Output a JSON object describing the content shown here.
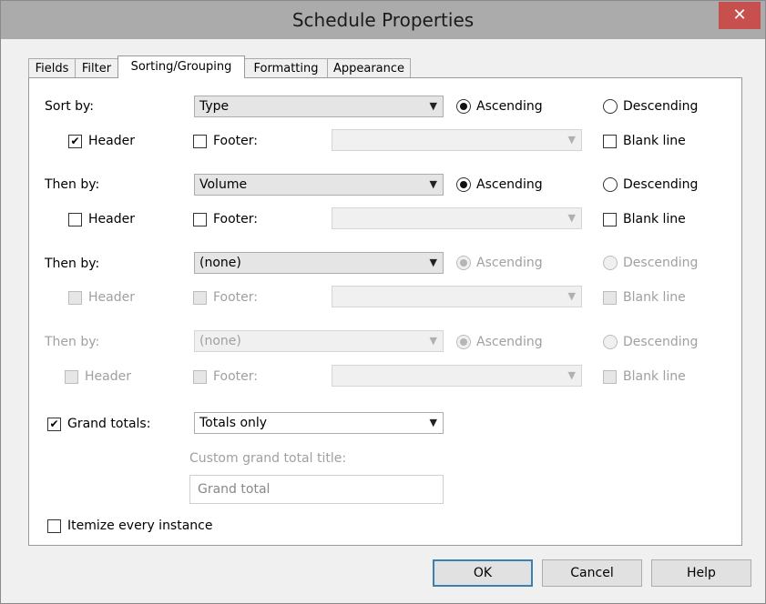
{
  "window": {
    "title": "Schedule Properties",
    "close_label": "✕"
  },
  "tabs": [
    {
      "label": "Fields"
    },
    {
      "label": "Filter"
    },
    {
      "label": "Sorting/Grouping"
    },
    {
      "label": "Formatting"
    },
    {
      "label": "Appearance"
    }
  ],
  "active_tab": "Sorting/Grouping",
  "sort_rows": [
    {
      "label": "Sort by:",
      "field": "Type",
      "ascending": "Ascending",
      "descending": "Descending",
      "order": "ascending",
      "header": "Header",
      "header_checked": true,
      "footer": "Footer:",
      "footer_checked": false,
      "footer_value": "",
      "blank_line": "Blank line",
      "blank_checked": false,
      "enabled": true
    },
    {
      "label": "Then by:",
      "field": "Volume",
      "ascending": "Ascending",
      "descending": "Descending",
      "order": "ascending",
      "header": "Header",
      "header_checked": false,
      "footer": "Footer:",
      "footer_checked": false,
      "footer_value": "",
      "blank_line": "Blank line",
      "blank_checked": false,
      "enabled": true
    },
    {
      "label": "Then by:",
      "field": "(none)",
      "ascending": "Ascending",
      "descending": "Descending",
      "order": "ascending",
      "header": "Header",
      "header_checked": false,
      "footer": "Footer:",
      "footer_checked": false,
      "footer_value": "",
      "blank_line": "Blank line",
      "blank_checked": false,
      "enabled": "field-only"
    },
    {
      "label": "Then by:",
      "field": "(none)",
      "ascending": "Ascending",
      "descending": "Descending",
      "order": "ascending",
      "header": "Header",
      "header_checked": false,
      "footer": "Footer:",
      "footer_checked": false,
      "footer_value": "",
      "blank_line": "Blank line",
      "blank_checked": false,
      "enabled": false
    }
  ],
  "grand_totals": {
    "label": "Grand totals:",
    "checked": true,
    "value": "Totals only",
    "custom_title_label": "Custom grand total title:",
    "custom_title_value": "Grand total"
  },
  "itemize": {
    "label": "Itemize every instance",
    "checked": false
  },
  "buttons": {
    "ok": "OK",
    "cancel": "Cancel",
    "help": "Help"
  },
  "icons": {
    "dropdown": "chevron-down-icon",
    "check": "checkmark-icon",
    "close": "close-icon"
  },
  "colors": {
    "titlebar": "#ababab",
    "close": "#c7504f",
    "panel": "#ffffff",
    "default_button_border": "#3c7fb1"
  }
}
